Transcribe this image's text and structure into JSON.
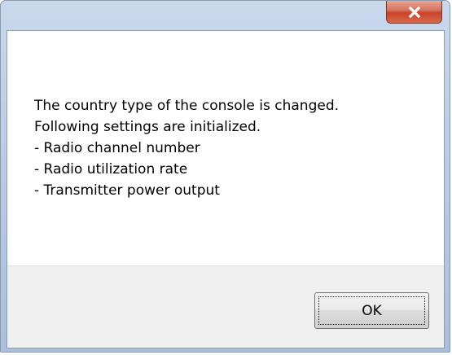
{
  "window": {
    "close_button": {
      "icon": "close-x-icon",
      "color": "#c8432a"
    }
  },
  "dialog": {
    "message_lines": [
      "The country type of the console is changed.",
      "Following settings are initialized.",
      " - Radio channel number",
      " - Radio utilization rate",
      " - Transmitter power output"
    ],
    "ok_label": "OK"
  }
}
